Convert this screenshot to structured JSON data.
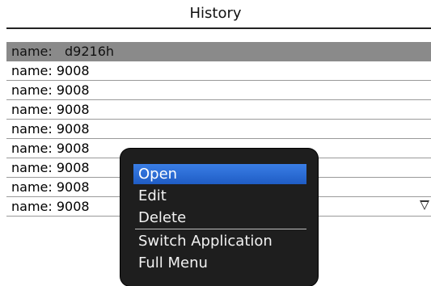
{
  "header": {
    "title": "History"
  },
  "list": {
    "items": [
      {
        "label": "name:   d9216h"
      },
      {
        "label": "name: 9008"
      },
      {
        "label": "name: 9008"
      },
      {
        "label": "name: 9008"
      },
      {
        "label": "name: 9008"
      },
      {
        "label": "name: 9008"
      },
      {
        "label": "name: 9008"
      },
      {
        "label": "name: 9008"
      },
      {
        "label": "name: 9008"
      }
    ],
    "more_indicator": "down-triangle-icon"
  },
  "context_menu": {
    "items": [
      {
        "label": "Open"
      },
      {
        "label": "Edit"
      },
      {
        "label": "Delete"
      },
      {
        "label": "Switch Application"
      },
      {
        "label": "Full Menu"
      }
    ]
  },
  "colors": {
    "selected_row": "#8a8a8a",
    "menu_background": "#1e1e1e",
    "menu_highlight": "#2e6fd8"
  }
}
